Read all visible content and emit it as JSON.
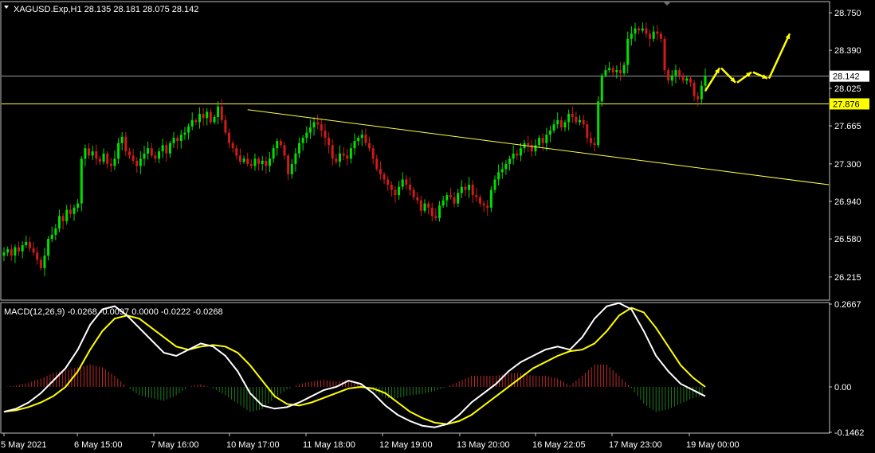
{
  "header": {
    "symbol_line": "XAGUSD.Exp,H1  28.135 28.181 28.075 28.142",
    "macd_line": "MACD(12,26,9) -0.0268 -0.0097 0.0000 -0.0222 -0.0268"
  },
  "colors": {
    "background": "#000000",
    "bull": "#00e000",
    "bear": "#d11a1a",
    "grid": "#c0c0c0",
    "hline_yellow": "#ffff40",
    "hline_gray": "#a0a0a0",
    "macd_main": "#ffffff",
    "macd_signal": "#ffff00",
    "hist_pos": "#c02a2a",
    "hist_neg": "#1f7a1f",
    "arrow": "#ffff00"
  },
  "price_labels": {
    "current": "28.142",
    "level": "27.876"
  },
  "chart_data": [
    {
      "type": "candlestick",
      "symbol": "XAGUSD.Exp",
      "timeframe": "H1",
      "ylim": [
        26.0,
        28.85
      ],
      "y_ticks": [
        "28.750",
        "28.390",
        "28.025",
        "27.665",
        "27.300",
        "26.940",
        "26.580",
        "26.215"
      ],
      "x_ticks": [
        "5 May 2021",
        "6 May 15:00",
        "7 May 16:00",
        "10 May 17:00",
        "11 May 18:00",
        "12 May 19:00",
        "13 May 20:00",
        "16 May 22:05",
        "17 May 23:00",
        "19 May 00:00"
      ],
      "closes": [
        26.45,
        26.48,
        26.42,
        26.5,
        26.46,
        26.52,
        26.55,
        26.49,
        26.45,
        26.38,
        26.3,
        26.42,
        26.58,
        26.62,
        26.68,
        26.8,
        26.75,
        26.86,
        26.82,
        26.88,
        26.92,
        27.35,
        27.45,
        27.38,
        27.42,
        27.35,
        27.32,
        27.4,
        27.3,
        27.28,
        27.35,
        27.5,
        27.56,
        27.42,
        27.38,
        27.33,
        27.28,
        27.35,
        27.4,
        27.45,
        27.38,
        27.35,
        27.42,
        27.48,
        27.4,
        27.5,
        27.55,
        27.52,
        27.58,
        27.6,
        27.66,
        27.72,
        27.7,
        27.78,
        27.74,
        27.8,
        27.7,
        27.75,
        27.85,
        27.72,
        27.6,
        27.5,
        27.45,
        27.38,
        27.32,
        27.35,
        27.3,
        27.28,
        27.35,
        27.3,
        27.33,
        27.28,
        27.35,
        27.45,
        27.52,
        27.48,
        27.38,
        27.2,
        27.3,
        27.4,
        27.5,
        27.55,
        27.6,
        27.65,
        27.7,
        27.68,
        27.62,
        27.55,
        27.48,
        27.35,
        27.32,
        27.4,
        27.38,
        27.35,
        27.45,
        27.52,
        27.55,
        27.58,
        27.5,
        27.45,
        27.35,
        27.25,
        27.2,
        27.15,
        27.1,
        27.05,
        27.0,
        27.08,
        27.15,
        27.1,
        27.05,
        26.98,
        26.95,
        26.85,
        26.92,
        26.88,
        26.8,
        26.78,
        26.9,
        26.95,
        27.0,
        26.98,
        26.92,
        27.02,
        27.08,
        27.05,
        27.1,
        27.0,
        26.98,
        26.92,
        26.9,
        26.88,
        27.05,
        27.15,
        27.22,
        27.25,
        27.3,
        27.35,
        27.4,
        27.38,
        27.45,
        27.5,
        27.48,
        27.42,
        27.48,
        27.55,
        27.5,
        27.58,
        27.62,
        27.68,
        27.72,
        27.65,
        27.7,
        27.78,
        27.75,
        27.7,
        27.72,
        27.68,
        27.55,
        27.5,
        27.48,
        27.9,
        28.15,
        28.2,
        28.22,
        28.18,
        28.2,
        28.17,
        28.25,
        28.5,
        28.55,
        28.6,
        28.58,
        28.6,
        28.55,
        28.5,
        28.57,
        28.55,
        28.5,
        28.2,
        28.1,
        28.15,
        28.2,
        28.15,
        28.1,
        28.12,
        28.08,
        27.95,
        27.92,
        28.05,
        28.142
      ],
      "trendline": {
        "from_index": 66,
        "from_price": 27.82,
        "to_price": 27.1
      },
      "horizontal_lines": [
        27.876,
        28.142
      ],
      "projection_arrows": [
        [
          28.0,
          28.22
        ],
        [
          28.22,
          28.08
        ],
        [
          28.08,
          28.18
        ],
        [
          28.18,
          28.12
        ],
        [
          28.12,
          28.55
        ]
      ]
    },
    {
      "type": "macd",
      "name": "MACD(12,26,9)",
      "ylim": [
        -0.1462,
        0.2667
      ],
      "y_ticks": [
        "0.2667",
        "0.00",
        "-0.1462"
      ],
      "main": [
        -0.08,
        -0.07,
        -0.05,
        -0.02,
        0.02,
        0.06,
        0.12,
        0.2,
        0.25,
        0.26,
        0.23,
        0.19,
        0.15,
        0.11,
        0.1,
        0.12,
        0.14,
        0.13,
        0.1,
        0.05,
        -0.02,
        -0.06,
        -0.07,
        -0.065,
        -0.05,
        -0.03,
        -0.01,
        0.0,
        0.02,
        0.01,
        -0.02,
        -0.06,
        -0.09,
        -0.11,
        -0.125,
        -0.13,
        -0.12,
        -0.09,
        -0.05,
        -0.02,
        0.01,
        0.05,
        0.08,
        0.1,
        0.12,
        0.13,
        0.12,
        0.16,
        0.22,
        0.26,
        0.27,
        0.25,
        0.18,
        0.1,
        0.05,
        0.01,
        -0.01,
        -0.03
      ],
      "signal": [
        -0.08,
        -0.075,
        -0.065,
        -0.05,
        -0.03,
        0.0,
        0.05,
        0.12,
        0.18,
        0.22,
        0.23,
        0.22,
        0.19,
        0.16,
        0.13,
        0.12,
        0.13,
        0.135,
        0.13,
        0.11,
        0.07,
        0.02,
        -0.03,
        -0.055,
        -0.06,
        -0.05,
        -0.035,
        -0.02,
        -0.005,
        0.0,
        -0.005,
        -0.02,
        -0.05,
        -0.08,
        -0.1,
        -0.115,
        -0.12,
        -0.11,
        -0.09,
        -0.06,
        -0.03,
        0.0,
        0.03,
        0.06,
        0.08,
        0.1,
        0.115,
        0.12,
        0.14,
        0.18,
        0.23,
        0.255,
        0.24,
        0.19,
        0.13,
        0.07,
        0.03,
        0.0
      ],
      "histogram_visible_range": [
        -0.0268,
        0.06
      ]
    }
  ]
}
